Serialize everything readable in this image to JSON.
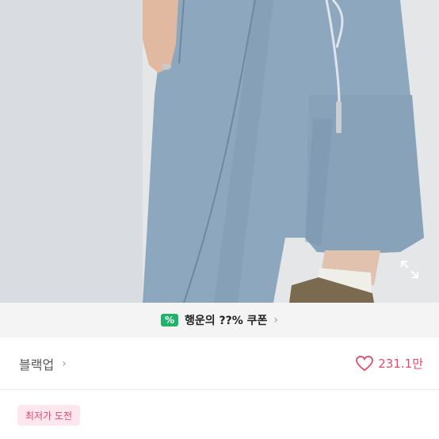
{
  "coupon": {
    "text": "행운의 ??% 쿠폰",
    "icon_symbol": "%",
    "icon_name": "coupon-percent-icon",
    "accent": "#1fb36b"
  },
  "shop": {
    "name": "블랙업",
    "like_count": "231.1만",
    "like_color": "#e64a6b"
  },
  "badge": {
    "label": "최저가 도전"
  },
  "colors": {
    "shorts": "#8fa8bf",
    "background": "#e7e8ea"
  }
}
